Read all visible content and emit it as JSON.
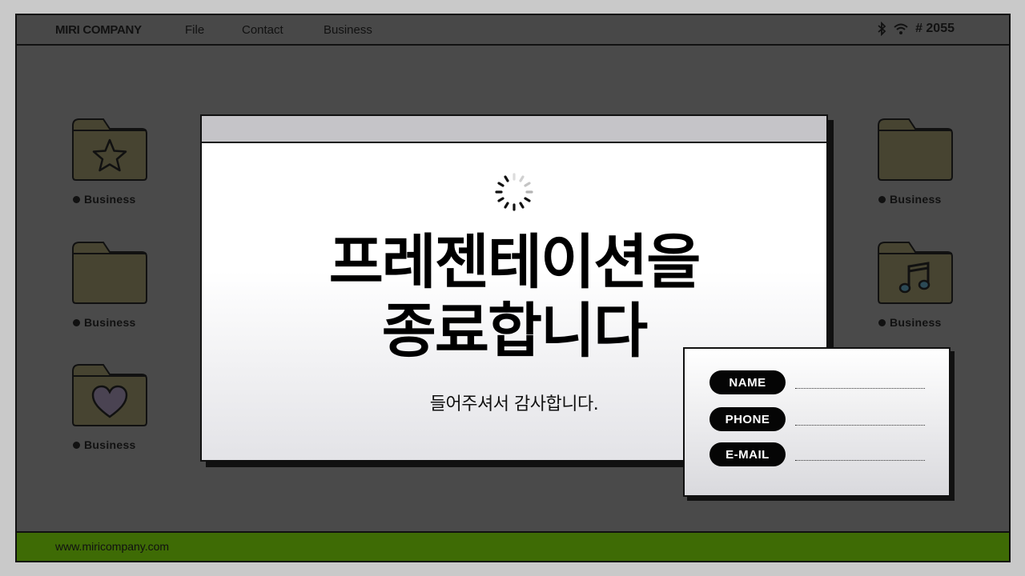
{
  "menubar": {
    "brand": "MIRI COMPANY",
    "items": [
      "File",
      "Contact",
      "Business"
    ],
    "status": {
      "bluetooth_icon": "bluetooth-icon",
      "wifi_icon": "wifi-icon",
      "code": "# 2055"
    }
  },
  "desktop": {
    "left": [
      {
        "label": "Business",
        "icon": "star-icon"
      },
      {
        "label": "Business",
        "icon": "none"
      },
      {
        "label": "Business",
        "icon": "heart-icon"
      }
    ],
    "right": [
      {
        "label": "Business",
        "icon": "none"
      },
      {
        "label": "Business",
        "icon": "music-note-icon"
      }
    ]
  },
  "window": {
    "title_line1": "프레젠테이션을",
    "title_line2": "종료합니다",
    "subtitle": "들어주셔서 감사합니다."
  },
  "contact": {
    "fields": [
      "NAME",
      "PHONE",
      "E-MAIL"
    ]
  },
  "footer": {
    "url": "www.miricompany.com"
  },
  "colors": {
    "background": "#4a4a4a",
    "folder": "#474431",
    "footer": "#3e6b05",
    "pill": "#050505"
  }
}
